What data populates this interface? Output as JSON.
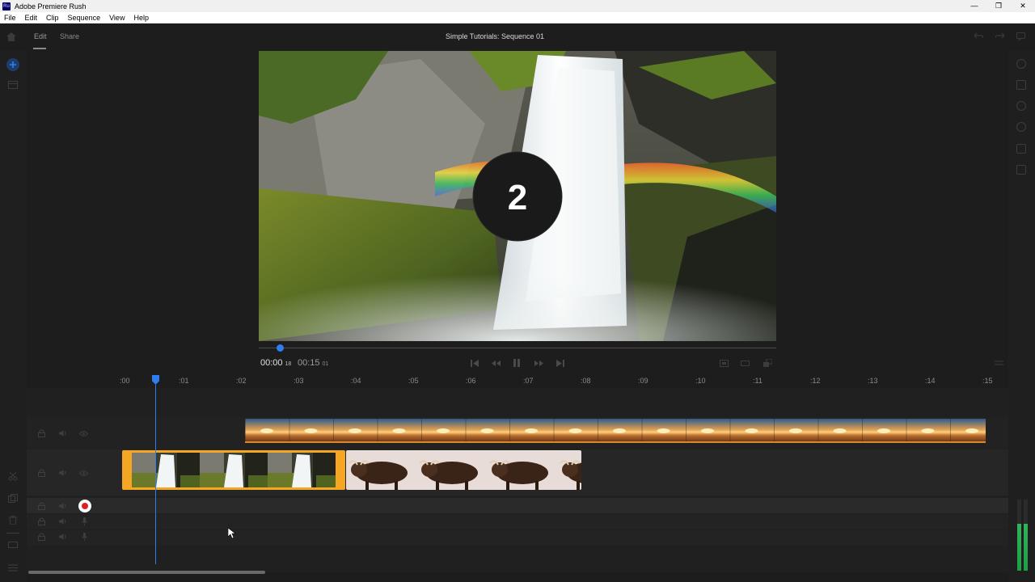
{
  "window": {
    "app_icon": "Ru",
    "title": "Adobe Premiere Rush",
    "controls": [
      "—",
      "❐",
      "✕"
    ]
  },
  "menu": [
    "File",
    "Edit",
    "Clip",
    "Sequence",
    "View",
    "Help"
  ],
  "tabs": {
    "edit": "Edit",
    "share": "Share"
  },
  "sequence_title": "Simple Tutorials: Sequence 01",
  "viewer": {
    "overlay_number": "2"
  },
  "playback": {
    "current_time": "00:00",
    "current_frames": "18",
    "duration_time": "00:15",
    "duration_frames": "01",
    "scrub_position": 0.04
  },
  "ruler": {
    "ticks": [
      ":00",
      ":01",
      ":02",
      ":03",
      ":04",
      ":05",
      ":06",
      ":07",
      ":08",
      ":09",
      ":10",
      ":11",
      ":12",
      ":13",
      ":14",
      ":15"
    ],
    "playhead_time": 0.55
  },
  "tracks": {
    "video2": {
      "clip": "desert-sunset-clip"
    },
    "video1": {
      "clips": [
        "waterfall-clip",
        "highland-cattle-clip"
      ]
    },
    "audio": {
      "record_icon": "record-icon"
    }
  },
  "colors": {
    "accent": "#2f7ef0",
    "selected_clip": "#f5a623",
    "record": "#e02020",
    "meter": "#2fb55a"
  },
  "icons": [
    "home-icon",
    "add-icon",
    "media-icon",
    "undo-icon",
    "redo-icon",
    "comment-icon",
    "lock-icon",
    "speaker-icon",
    "eye-icon",
    "mic-icon",
    "scissors-icon",
    "duplicate-icon",
    "trash-icon",
    "list-icon"
  ]
}
